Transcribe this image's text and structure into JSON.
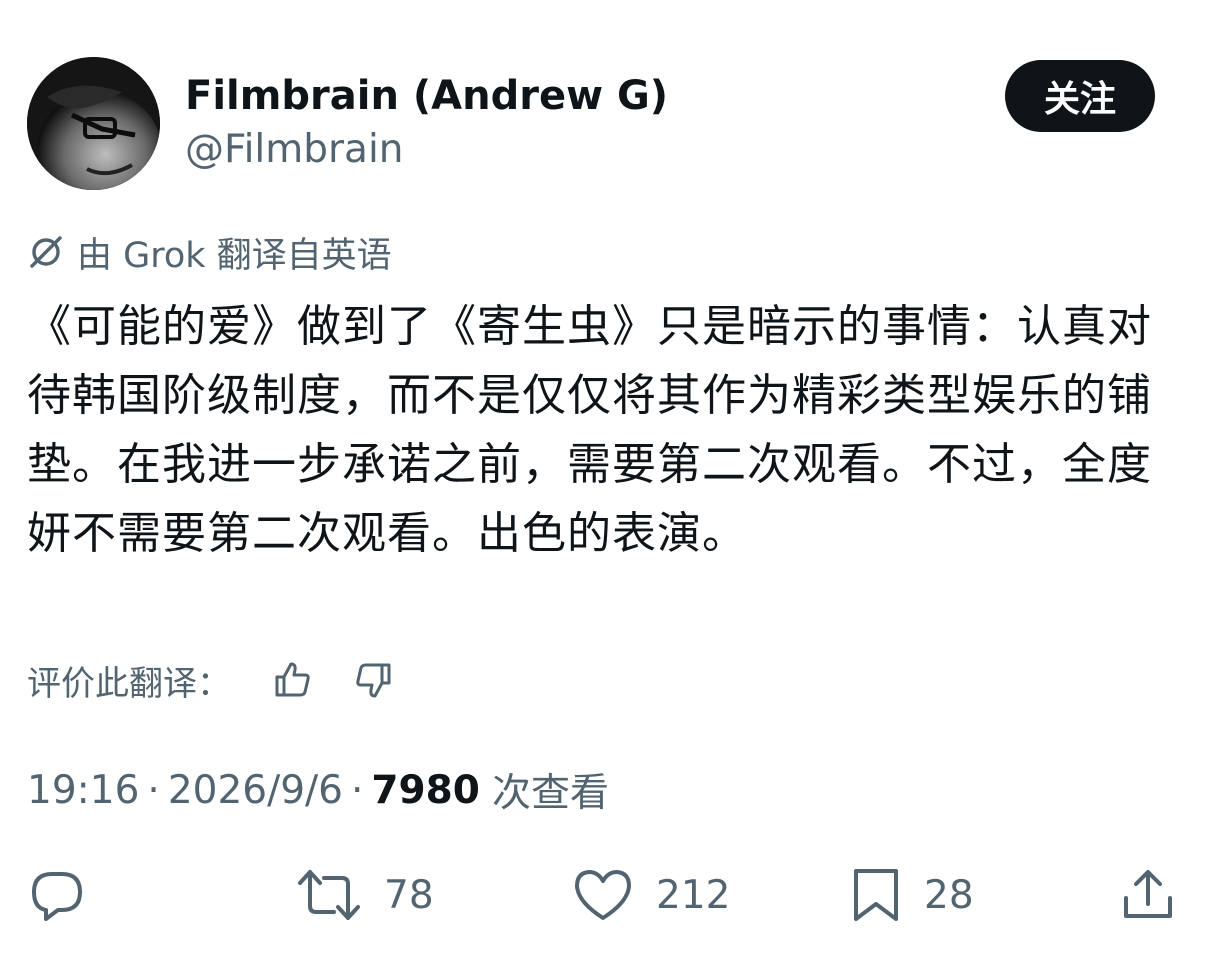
{
  "author": {
    "name": "Filmbrain (Andrew G)",
    "handle": "@Filmbrain",
    "follow_label": "关注"
  },
  "translation": {
    "note": "由 Grok 翻译自英语",
    "rate_label": "评价此翻译："
  },
  "tweet": {
    "text": "《可能的爱》做到了《寄生虫》只是暗示的事情：认真对待韩国阶级制度，而不是仅仅将其作为精彩类型娱乐的铺垫。在我进一步承诺之前，需要第二次观看。不过，全度妍不需要第二次观看。出色的表演。"
  },
  "meta": {
    "time": "19:16",
    "separator": "·",
    "date": "2026/9/6",
    "views_count": "7980",
    "views_label": "次查看"
  },
  "actions": {
    "replies": "",
    "retweets": "78",
    "likes": "212",
    "bookmarks": "28"
  },
  "icons": {
    "translate": "grok-icon",
    "rate_up": "thumbs-up-icon",
    "rate_down": "thumbs-down-icon",
    "reply": "reply-icon",
    "retweet": "retweet-icon",
    "like": "heart-icon",
    "bookmark": "bookmark-icon",
    "share": "share-icon"
  },
  "colors": {
    "text_primary": "#0f1419",
    "text_secondary": "#536471",
    "follow_button_bg": "#0f1419",
    "follow_button_text": "#ffffff"
  }
}
